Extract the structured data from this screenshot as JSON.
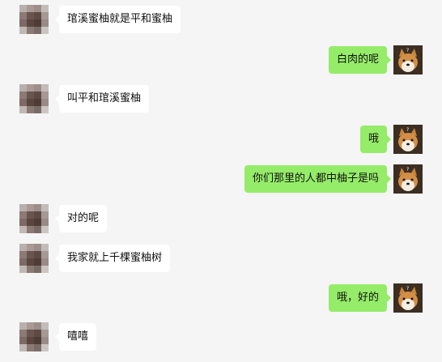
{
  "chat": {
    "messages": [
      {
        "side": "left",
        "text": "琯溪蜜柚就是平和蜜柚"
      },
      {
        "side": "right",
        "text": "白肉的呢"
      },
      {
        "side": "left",
        "text": "叫平和琯溪蜜柚"
      },
      {
        "side": "right",
        "text": "哦"
      },
      {
        "side": "right",
        "text": "你们那里的人都中柚子是吗"
      },
      {
        "side": "left",
        "text": "对的呢"
      },
      {
        "side": "left",
        "text": "我家就上千棵蜜柚树"
      },
      {
        "side": "right",
        "text": "哦，好的"
      },
      {
        "side": "left",
        "text": "嘻嘻"
      }
    ]
  },
  "colors": {
    "background": "#f5f5f5",
    "incoming_bubble": "#ffffff",
    "outgoing_bubble": "#95ec69"
  },
  "avatars": {
    "contact": "pixelated-avatar",
    "self": "shiba-dog-avatar"
  }
}
